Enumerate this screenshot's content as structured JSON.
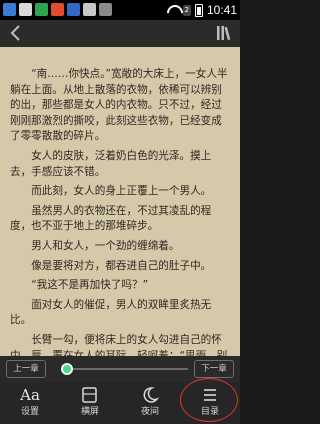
{
  "status_bar": {
    "time": "10:41",
    "sim_label": "2"
  },
  "top_bar": {
    "back_icon": "back-arrow-icon",
    "bookshelf_icon": "bookshelf-icon"
  },
  "content": {
    "paragraphs": [
      "“南……你快点。”宽敞的大床上，一女人半躺在上面。从地上散落的衣物，依稀可以辨别的出，那些都是女人的内衣物。只不过，经过刚刚那激烈的撕咬，此刻这些衣物，已经变成了零零散散的碎片。",
      "女人的皮肤，泛着奶白色的光泽。摸上去，手感应该不错。",
      "而此刻，女人的身上正覆上一个男人。",
      "虽然男人的衣物还在，不过其凌乱的程度，也不亚于地上的那堆碎步。",
      "男人和女人，一个劲的缠绵着。",
      "像是要将对方，都吞进自己的肚子中。",
      "“我这不是再加快了吗？”",
      "面对女人的催促，男人的双眸里炙热无比。",
      "长臂一勾，便将床上的女人勾进自己的怀中。唇，覆在女人的耳际，轻呵着：“思雨，别这么急。”"
    ]
  },
  "progress": {
    "prev_label": "上一章",
    "next_label": "下一章",
    "value_fraction": 0.04
  },
  "bottom_nav": {
    "items": [
      {
        "label": "设置",
        "icon": "font-settings-icon",
        "glyph": "Aa"
      },
      {
        "label": "横屏",
        "icon": "landscape-icon"
      },
      {
        "label": "夜间",
        "icon": "night-mode-icon"
      },
      {
        "label": "目录",
        "icon": "table-of-contents-icon"
      }
    ]
  },
  "colors": {
    "page_background": "#d6c9a9",
    "slider_accent": "#3fc87a",
    "highlight_ring": "#e0342d"
  }
}
